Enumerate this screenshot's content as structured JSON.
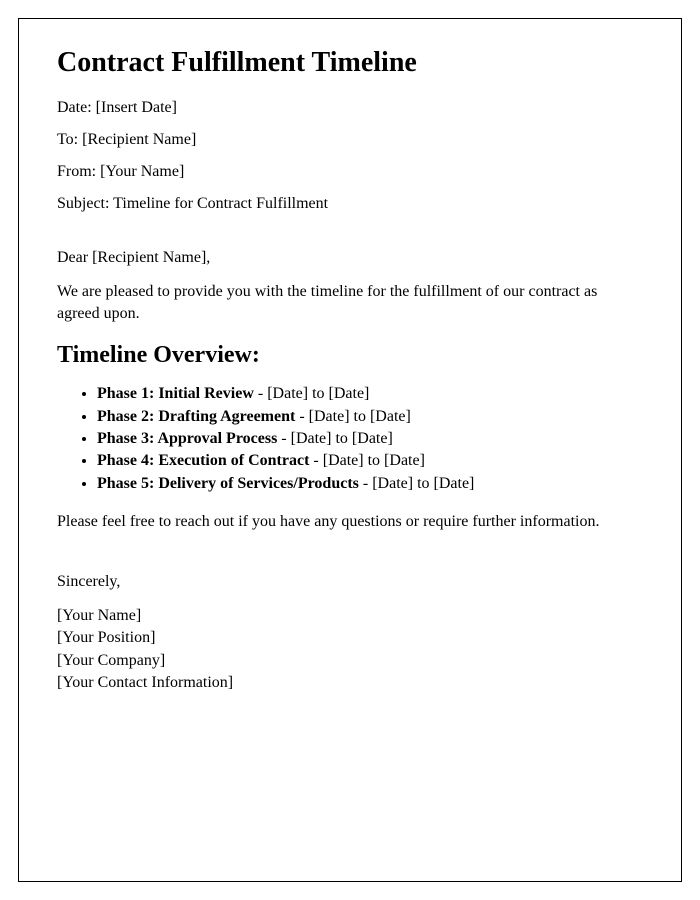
{
  "title": "Contract Fulfillment Timeline",
  "meta": {
    "date_label": "Date: ",
    "date_value": "[Insert Date]",
    "to_label": "To: ",
    "to_value": "[Recipient Name]",
    "from_label": "From: ",
    "from_value": "[Your Name]",
    "subject_label": "Subject: ",
    "subject_value": "Timeline for Contract Fulfillment"
  },
  "salutation_prefix": "Dear ",
  "salutation_name": "[Recipient Name]",
  "salutation_suffix": ",",
  "intro": "We are pleased to provide you with the timeline for the fulfillment of our contract as agreed upon.",
  "timeline_heading": "Timeline Overview:",
  "phases": [
    {
      "title": "Phase 1: Initial Review",
      "range": " - [Date] to [Date]"
    },
    {
      "title": "Phase 2: Drafting Agreement",
      "range": " - [Date] to [Date]"
    },
    {
      "title": "Phase 3: Approval Process",
      "range": " - [Date] to [Date]"
    },
    {
      "title": "Phase 4: Execution of Contract",
      "range": " - [Date] to [Date]"
    },
    {
      "title": "Phase 5: Delivery of Services/Products",
      "range": " - [Date] to [Date]"
    }
  ],
  "outro": "Please feel free to reach out if you have any questions or require further information.",
  "closing": "Sincerely,",
  "signature": {
    "name": "[Your Name]",
    "position": "[Your Position]",
    "company": "[Your Company]",
    "contact": "[Your Contact Information]"
  }
}
